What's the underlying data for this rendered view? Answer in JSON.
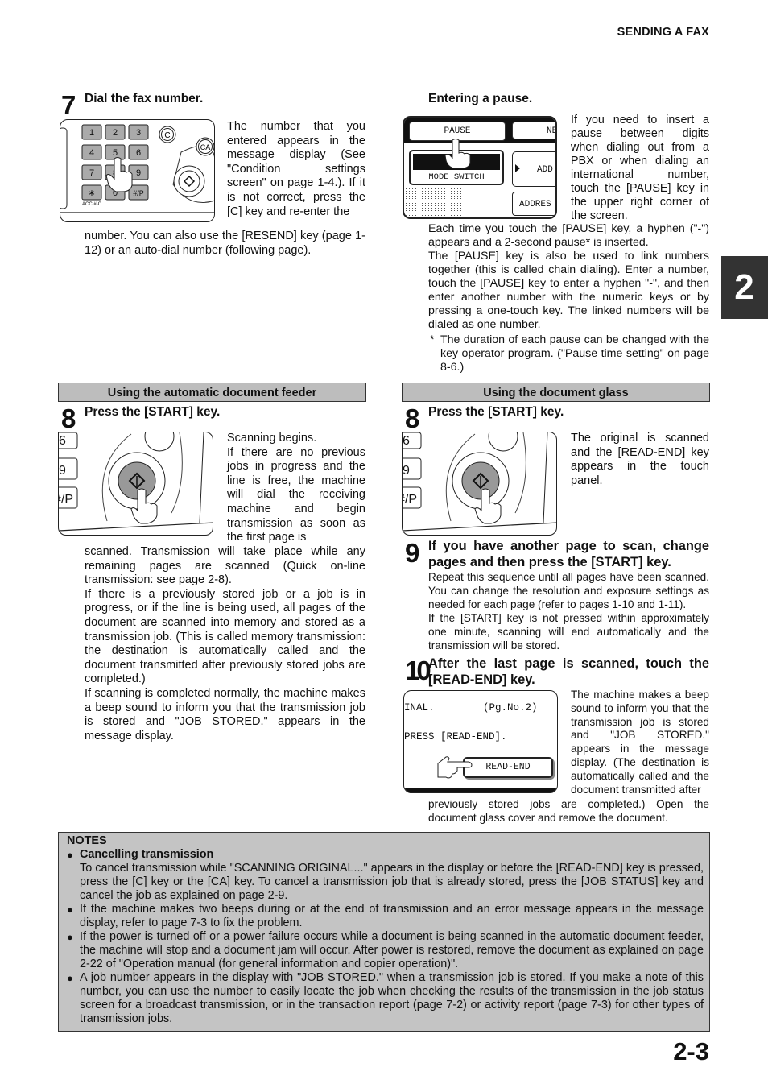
{
  "header": {
    "section_title": "SENDING A FAX"
  },
  "chapter_tab": "2",
  "page_number": "2-3",
  "step7": {
    "number": "7",
    "title": "Dial the fax number.",
    "text_side": "The number that you entered appears in the message display (See \"Condition settings screen\" on page 1-4.). If it is not correct, press the [C] key and re-enter the",
    "text_below": "number. You can also use the [RESEND] key (page 1-12) or an auto-dial number (following page).",
    "keypad": {
      "keys": [
        "1",
        "2",
        "3",
        "4",
        "5",
        "6",
        "7",
        "8",
        "9",
        "∗",
        "0",
        "#/P"
      ],
      "acc_label": "ACC.#-C",
      "c_key": "C",
      "ca_key": "CA"
    }
  },
  "pause": {
    "title": "Entering a pause.",
    "text_side": "If you need to insert a pause between digits when dialing out from a PBX or when dialing an international number, touch the [PAUSE] key in the upper right corner of the screen.",
    "text_below_1": "Each time you touch the [PAUSE] key, a hyphen (\"-\") appears and a 2-second pause* is inserted.",
    "text_below_2": "The [PAUSE] key is also be used to link numbers together (this is called chain dialing). Enter a number, touch the [PAUSE] key to enter a hyphen \"-\", and then enter another number with the numeric keys or by pressing a one-touch key. The linked numbers will be dialed as one number.",
    "footnote_mark": "*",
    "footnote": "The duration of each pause can be changed with the key operator program. (\"Pause time setting\" on page 8-6.)",
    "screen": {
      "pause_key": "PAUSE",
      "next_key": "NE",
      "mode_switch": "MODE SWITCH",
      "add_key": "ADD",
      "address_key": "ADDRES"
    }
  },
  "adf": {
    "bar_label": "Using the automatic document feeder",
    "number": "8",
    "title": "Press the [START] key.",
    "text_side": "Scanning begins.\nIf there are no previous jobs in progress and the line is free, the machine will dial the receiving machine and begin transmission as soon as the first page is",
    "text_below": "scanned. Transmission will take place while any remaining pages are scanned (Quick on-line transmission: see page 2-8).\nIf there is a previously stored job or a job is in progress, or if the line is being used, all pages of the document are scanned into memory and stored as a transmission job. (This is called memory transmission: the destination is automatically called and the document transmitted after previously stored jobs are completed.)\nIf scanning is completed normally, the machine makes a beep sound to inform you that the transmission job is stored and \"JOB STORED.\" appears in the message display.",
    "keys": [
      "6",
      "9",
      "#/P"
    ]
  },
  "glass": {
    "bar_label": "Using the document glass",
    "number": "8",
    "title": "Press the [START] key.",
    "text_side": "The original is scanned and the [READ-END] key appears in the touch panel.",
    "keys": [
      "6",
      "9",
      "#/P"
    ]
  },
  "step9": {
    "number": "9",
    "title": "If you have another page to scan, change pages and then press the [START] key.",
    "text": "Repeat this sequence until all pages have been scanned. You can change the resolution and exposure settings as needed for each page (refer to pages 1-10 and 1-11).\nIf the [START] key is not pressed within approximately one minute, scanning will end automatically and the transmission will be stored."
  },
  "step10": {
    "number": "10",
    "title": "After the last page is scanned, touch the [READ-END] key.",
    "text_side": "The machine makes a beep sound to inform you that the transmission job is stored and \"JOB STORED.\" appears in the message display. (The destination is automatically called and the document transmitted after",
    "text_below": "previously stored jobs are completed.) Open the document glass cover and remove the document.",
    "screen": {
      "line1_left": "INAL.",
      "line1_right": "(Pg.No.2)",
      "line2": "PRESS [READ-END].",
      "read_end_key": "READ-END"
    }
  },
  "notes": {
    "title": "NOTES",
    "items": [
      {
        "heading": "Cancelling transmission",
        "text": "To cancel transmission while \"SCANNING ORIGINAL...\" appears in the display or before the [READ-END] key is pressed, press the [C] key or the [CA] key. To cancel a transmission job that is already stored, press the [JOB STATUS] key and cancel the job as explained on page 2-9."
      },
      {
        "text": "If the machine makes two beeps during or at the end of transmission and an error message appears in the message display, refer to page 7-3 to fix the problem."
      },
      {
        "text": "If the power is turned off or a power failure occurs while a document is being scanned in the automatic document feeder, the machine will stop and a document jam will occur. After power is restored, remove the document as explained on page 2-22 of \"Operation manual (for general information and copier operation)\"."
      },
      {
        "text": "A job number appears in the display with \"JOB STORED.\" when a transmission job is stored. If you make a note of this number, you can use the number to easily locate the job when checking the results of the transmission in the job status screen for a broadcast transmission, or in the transaction report (page 7-2) or activity report (page 7-3) for other types of transmission jobs."
      }
    ]
  }
}
